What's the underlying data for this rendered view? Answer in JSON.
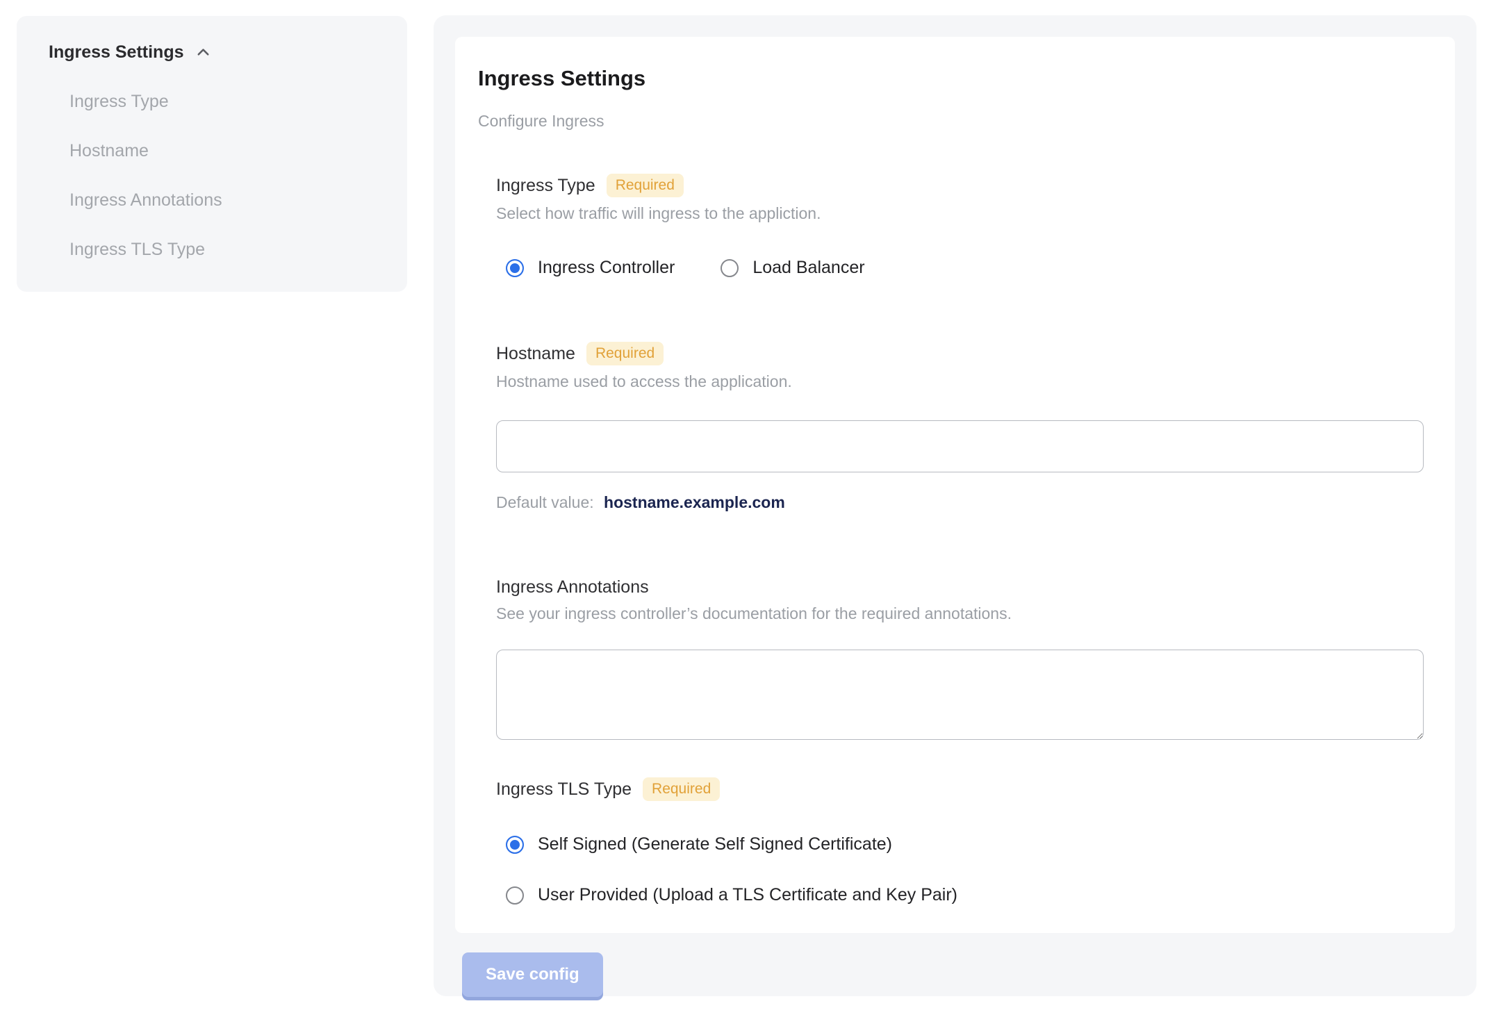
{
  "colors": {
    "accent_blue": "#2b6fe8",
    "badge_bg": "#fcf1d4",
    "badge_text": "#e1a138",
    "save_button_bg": "#aabced",
    "panel_bg": "#f5f6f8",
    "default_value_text": "#1b2550"
  },
  "sidebar": {
    "header": "Ingress Settings",
    "collapse_icon": "chevron-up-icon",
    "items": [
      {
        "label": "Ingress Type"
      },
      {
        "label": "Hostname"
      },
      {
        "label": "Ingress Annotations"
      },
      {
        "label": "Ingress TLS Type"
      }
    ]
  },
  "panel": {
    "title": "Ingress Settings",
    "subtitle": "Configure Ingress",
    "required_badge": "Required",
    "save_button": "Save config",
    "sections": {
      "ingress_type": {
        "label": "Ingress Type",
        "required": true,
        "helper": "Select how traffic will ingress to the appliction.",
        "options": [
          {
            "label": "Ingress Controller",
            "selected": true
          },
          {
            "label": "Load Balancer",
            "selected": false
          }
        ]
      },
      "hostname": {
        "label": "Hostname",
        "required": true,
        "helper": "Hostname used to access the application.",
        "value": "",
        "default_label": "Default value:",
        "default_value": "hostname.example.com"
      },
      "annotations": {
        "label": "Ingress Annotations",
        "required": false,
        "helper": "See your ingress controller’s documentation for the required annotations.",
        "value": ""
      },
      "tls": {
        "label": "Ingress TLS Type",
        "required": true,
        "options": [
          {
            "label": "Self Signed (Generate Self Signed Certificate)",
            "selected": true
          },
          {
            "label": "User Provided (Upload a TLS Certificate and Key Pair)",
            "selected": false
          }
        ]
      }
    }
  }
}
